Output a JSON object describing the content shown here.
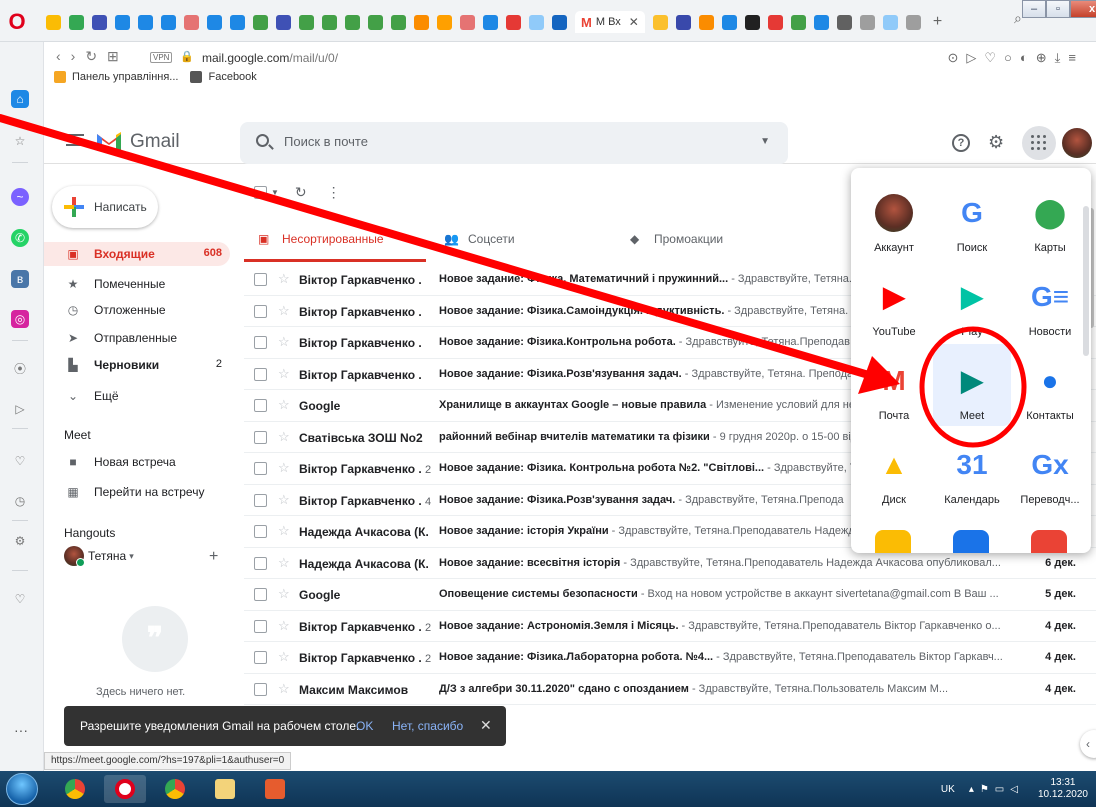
{
  "browser": {
    "active_tab_label": "M Вх",
    "url_host": "mail.google.com",
    "url_path": "/mail/u/0/",
    "vpn_label": "VPN",
    "bookmarks": [
      {
        "label": "Панель управління..."
      },
      {
        "label": "Facebook"
      }
    ]
  },
  "header": {
    "app_name": "Gmail",
    "search_placeholder": "Поиск в почте"
  },
  "compose_label": "Написать",
  "nav": [
    {
      "label": "Входящие",
      "count": "608",
      "icon": "inbox-icon",
      "glyph": "▣"
    },
    {
      "label": "Помеченные",
      "count": "",
      "icon": "star-icon",
      "glyph": "★"
    },
    {
      "label": "Отложенные",
      "count": "",
      "icon": "clock-icon",
      "glyph": "◷"
    },
    {
      "label": "Отправленные",
      "count": "",
      "icon": "send-icon",
      "glyph": "➤"
    },
    {
      "label": "Черновики",
      "count": "2",
      "icon": "draft-icon",
      "glyph": "▙"
    },
    {
      "label": "Ещё",
      "count": "",
      "icon": "chevron-down-icon",
      "glyph": "⌄"
    }
  ],
  "meet": {
    "title": "Meet",
    "new_meeting": "Новая встреча",
    "join_meeting": "Перейти на встречу"
  },
  "hangouts": {
    "title": "Hangouts",
    "user": "Тетяна",
    "empty_text": "Здесь ничего нет."
  },
  "tabs": [
    {
      "label": "Несортированные"
    },
    {
      "label": "Соцсети"
    },
    {
      "label": "Промоакции"
    }
  ],
  "messages": [
    {
      "from": "Віктор Гаркавченко .",
      "count": "",
      "subject": "Новое задание: Фізика. Математичний і пружинний...",
      "snippet": " - Здравствуйте, Тетяна.",
      "date": ""
    },
    {
      "from": "Віктор Гаркавченко .",
      "count": "",
      "subject": "Новое задание: Фізика.Самоіндукція. Індуктивність.",
      "snippet": " - Здравствуйте, Тетяна.",
      "date": ""
    },
    {
      "from": "Віктор Гаркавченко .",
      "count": "",
      "subject": "Новое задание: Фізика.Контрольна робота.",
      "snippet": " - Здравствуйте, Тетяна.Преподав",
      "date": ""
    },
    {
      "from": "Віктор Гаркавченко .",
      "count": "",
      "subject": "Новое задание: Фізика.Розв'язування задач.",
      "snippet": " - Здравствуйте, Тетяна. Препода",
      "date": ""
    },
    {
      "from": "Google",
      "count": "",
      "subject": "Хранилище в аккаунтах Google – новые правила",
      "snippet": " - Изменение условий для не",
      "date": ""
    },
    {
      "from": "Сватівська ЗОШ No2",
      "count": "",
      "subject": "районний вебінар вчителів математики та фізики",
      "snippet": " - 9 грудня 2020р. о 15-00 від",
      "date": ""
    },
    {
      "from": "Віктор Гаркавченко .",
      "count": "2",
      "subject": "Новое задание: Фізика. Контрольна робота №2. \"Світлові...",
      "snippet": " - Здравствуйте, Те",
      "date": ""
    },
    {
      "from": "Віктор Гаркавченко .",
      "count": "4",
      "subject": "Новое задание: Фізика.Розв'зування задач.",
      "snippet": " - Здравствуйте, Тетяна.Препода",
      "date": ""
    },
    {
      "from": "Надежда Ачкасова (К.",
      "count": "",
      "subject": "Новое задание: історія України",
      "snippet": " - Здравствуйте, Тетяна.Преподаватель Надежда Ачкасова опубликовал н...",
      "date": "6 дек."
    },
    {
      "from": "Надежда Ачкасова (К.",
      "count": "",
      "subject": "Новое задание: всесвітня історія",
      "snippet": " - Здравствуйте, Тетяна.Преподаватель Надежда Ачкасова опубликовал...",
      "date": "6 дек."
    },
    {
      "from": "Google",
      "count": "",
      "subject": "Оповещение системы безопасности",
      "snippet": " - Вход на новом устройстве в аккаунт sivertetana@gmail.com В Ваш ...",
      "date": "5 дек."
    },
    {
      "from": "Віктор Гаркавченко .",
      "count": "2",
      "subject": "Новое задание: Астрономія.Земля і Місяць.",
      "snippet": " - Здравствуйте, Тетяна.Преподаватель Віктор Гаркавченко о...",
      "date": "4 дек."
    },
    {
      "from": "Віктор Гаркавченко .",
      "count": "2",
      "subject": "Новое задание: Фізика.Лабораторна робота. №4...",
      "snippet": " - Здравствуйте, Тетяна.Преподаватель Віктор Гаркавч...",
      "date": "4 дек."
    },
    {
      "from": "Максим Максимов",
      "count": "",
      "subject": "Д/З з алгебри 30.11.2020\" сдано с опозданием",
      "snippet": " - Здравствуйте, Тетяна.Пользователь Максим М...",
      "date": "4 дек."
    }
  ],
  "apps": [
    {
      "label": "Аккаунт",
      "icon": "account-avatar-icon",
      "glyph": "",
      "color": "#8d4a3a"
    },
    {
      "label": "Поиск",
      "icon": "google-search-icon",
      "glyph": "G",
      "color": "#4285f4"
    },
    {
      "label": "Карты",
      "icon": "maps-icon",
      "glyph": "⬤",
      "color": "#34a853"
    },
    {
      "label": "YouTube",
      "icon": "youtube-icon",
      "glyph": "▶",
      "color": "#ff0000"
    },
    {
      "label": "Play",
      "icon": "play-store-icon",
      "glyph": "▶",
      "color": "#00c3a5"
    },
    {
      "label": "Новости",
      "icon": "news-icon",
      "glyph": "G≡",
      "color": "#4285f4"
    },
    {
      "label": "Почта",
      "icon": "gmail-icon",
      "glyph": "M",
      "color": "#ea4335"
    },
    {
      "label": "Meet",
      "icon": "meet-icon",
      "glyph": "▶",
      "color": "#00897b"
    },
    {
      "label": "Контакты",
      "icon": "contacts-icon",
      "glyph": "●",
      "color": "#1a73e8"
    },
    {
      "label": "Диск",
      "icon": "drive-icon",
      "glyph": "▲",
      "color": "#fbbc04"
    },
    {
      "label": "Календарь",
      "icon": "calendar-icon",
      "glyph": "31",
      "color": "#4285f4"
    },
    {
      "label": "Переводч...",
      "icon": "translate-icon",
      "glyph": "Gx",
      "color": "#4285f4"
    }
  ],
  "snackbar": {
    "text": "Разрешите уведомления Gmail на рабочем столе.",
    "ok": "OK",
    "no": "Нет, спасибо"
  },
  "status_url": "https://meet.google.com/?hs=197&pli=1&authuser=0",
  "taskbar": {
    "lang": "UK",
    "time": "13:31",
    "date": "10.12.2020"
  },
  "colors": {
    "gmail_red": "#d93025",
    "annotation_red": "#ff0000",
    "snackbar_bg": "#323232",
    "taskbar_bg": "#1c4b70"
  }
}
